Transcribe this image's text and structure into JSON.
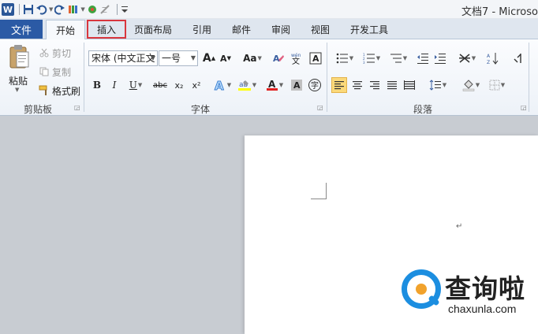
{
  "title_bar": {
    "window_title": "文档7 - Microso"
  },
  "tabs": {
    "file": "文件",
    "items": [
      "开始",
      "插入",
      "页面布局",
      "引用",
      "邮件",
      "审阅",
      "视图",
      "开发工具"
    ],
    "active": "开始",
    "highlighted": "插入"
  },
  "clipboard": {
    "paste": "粘贴",
    "cut": "剪切",
    "copy": "复制",
    "format_painter": "格式刷",
    "group_label": "剪贴板"
  },
  "font": {
    "font_name": "宋体 (中文正文",
    "font_size": "一号",
    "grow": "A",
    "shrink": "A",
    "change_case": "Aa",
    "bold": "B",
    "italic": "I",
    "underline": "U",
    "strikethrough": "abc",
    "subscript": "x₂",
    "superscript": "x²",
    "group_label": "字体"
  },
  "paragraph": {
    "group_label": "段落"
  },
  "document": {
    "paragraph_mark": "↵"
  },
  "watermark": {
    "brand": "查询啦",
    "domain": "chaxunla.com"
  },
  "colors": {
    "file_tab": "#2b5aa5",
    "highlight_box": "#d9363e",
    "watermark_blue": "#1c8ee0",
    "watermark_orange": "#f1a22c"
  }
}
